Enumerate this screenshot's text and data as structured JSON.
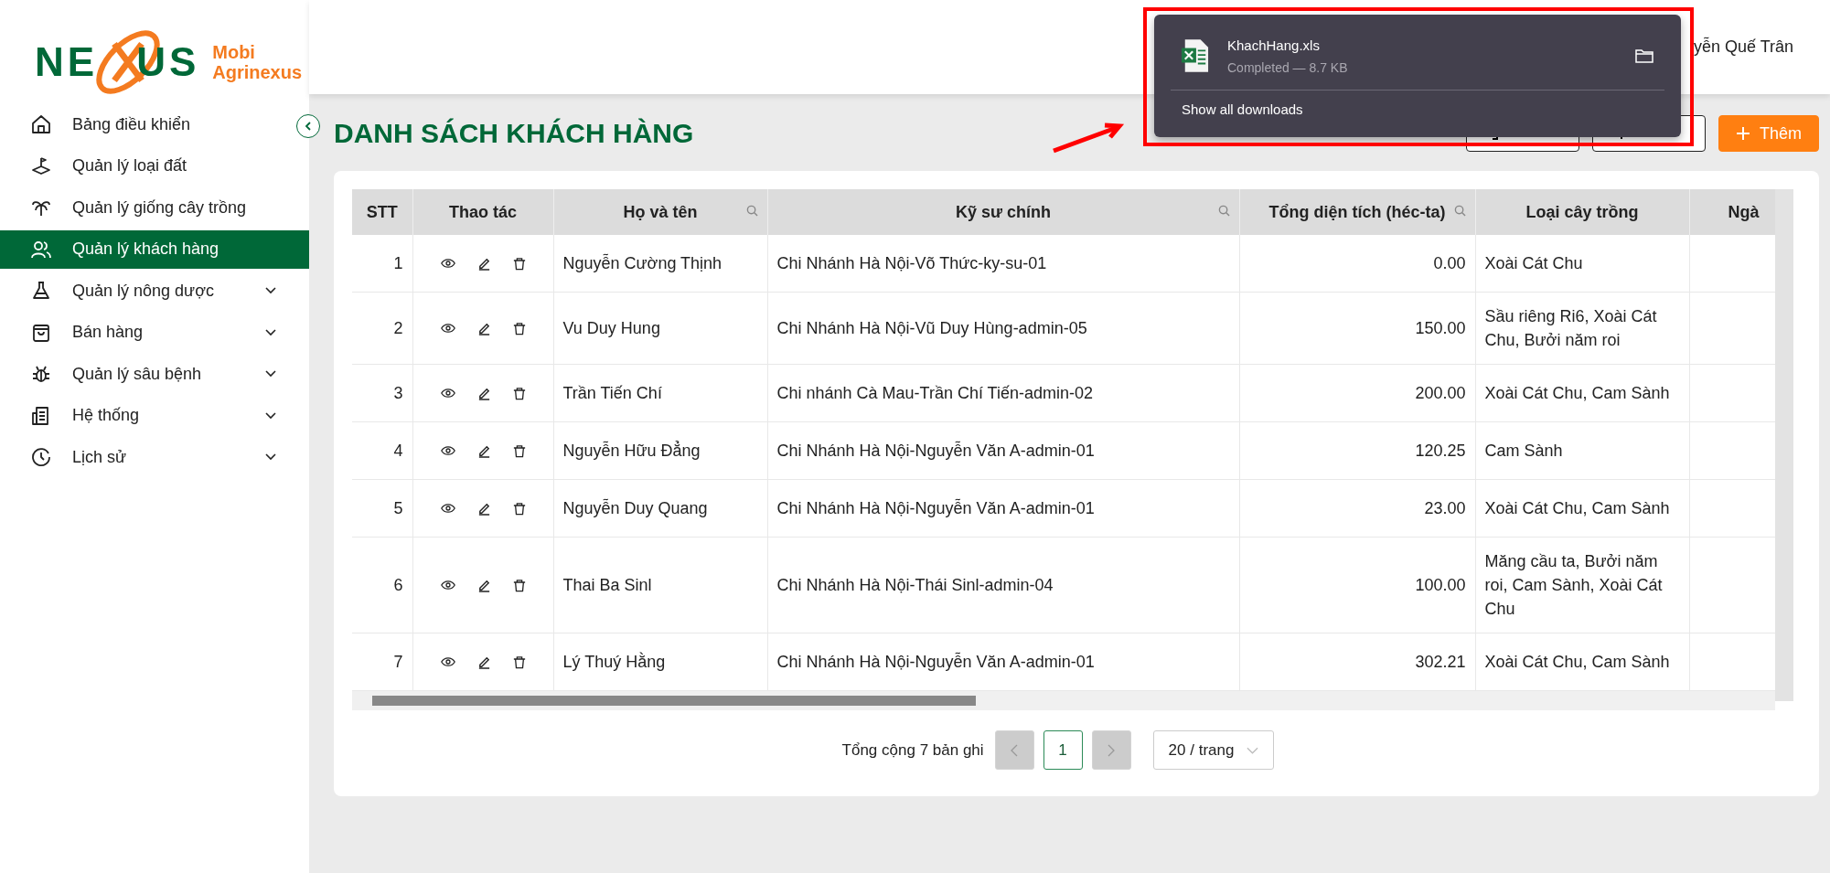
{
  "logo": {
    "wordmark_left": "NE",
    "wordmark_right": "US",
    "line1": "Mobi",
    "line2": "Agrinexus"
  },
  "sidebar": {
    "items": [
      {
        "label": "Bảng điều khiển",
        "kind": "home",
        "expandable": false,
        "selected": false
      },
      {
        "label": "Quản lý loại đất",
        "kind": "soil",
        "expandable": false,
        "selected": false
      },
      {
        "label": "Quản lý giống cây trồng",
        "kind": "palm",
        "expandable": false,
        "selected": false
      },
      {
        "label": "Quản lý khách hàng",
        "kind": "users",
        "expandable": false,
        "selected": true
      },
      {
        "label": "Quản lý nông dược",
        "kind": "flask",
        "expandable": true,
        "selected": false
      },
      {
        "label": "Bán hàng",
        "kind": "bag",
        "expandable": true,
        "selected": false
      },
      {
        "label": "Quản lý sâu bệnh",
        "kind": "bug",
        "expandable": true,
        "selected": false
      },
      {
        "label": "Hệ thống",
        "kind": "building",
        "expandable": true,
        "selected": false
      },
      {
        "label": "Lịch sử",
        "kind": "clock",
        "expandable": true,
        "selected": false
      }
    ]
  },
  "header": {
    "user_name": "yễn Quế Trân"
  },
  "page": {
    "title": "DANH SÁCH KHÁCH HÀNG",
    "buttons": [
      {
        "kind": "export"
      },
      {
        "kind": "import"
      },
      {
        "label": "Thêm",
        "kind": "add"
      }
    ]
  },
  "table": {
    "columns": [
      {
        "label": "STT",
        "kind": "index",
        "searchable": false
      },
      {
        "label": "Thao tác",
        "kind": "actions",
        "searchable": false
      },
      {
        "label": "Họ và tên",
        "kind": "text",
        "searchable": true
      },
      {
        "label": "Kỹ sư chính",
        "kind": "text",
        "searchable": true
      },
      {
        "label": "Tổng diện tích (héc-ta)",
        "kind": "number",
        "searchable": true
      },
      {
        "label": "Loại cây trồng",
        "kind": "text",
        "searchable": false
      },
      {
        "label": "Ngà",
        "kind": "text",
        "searchable": false
      }
    ],
    "rows": [
      {
        "stt": "1",
        "name": "Nguyễn Cường Thịnh",
        "engineer": "Chi Nhánh Hà Nội-Võ Thức-ky-su-01",
        "area": "0.00",
        "crops": "Xoài Cát Chu"
      },
      {
        "stt": "2",
        "name": "Vu Duy Hung",
        "engineer": "Chi Nhánh Hà Nội-Vũ Duy Hùng-admin-05",
        "area": "150.00",
        "crops": "Sầu riêng Ri6, Xoài Cát Chu, Bưởi năm roi"
      },
      {
        "stt": "3",
        "name": "Trần Tiến Chí",
        "engineer": "Chi nhánh Cà Mau-Trần Chí Tiến-admin-02",
        "area": "200.00",
        "crops": "Xoài Cát Chu, Cam Sành"
      },
      {
        "stt": "4",
        "name": "Nguyễn Hữu Đẳng",
        "engineer": "Chi Nhánh Hà Nội-Nguyễn Văn A-admin-01",
        "area": "120.25",
        "crops": "Cam Sành"
      },
      {
        "stt": "5",
        "name": "Nguyễn Duy Quang",
        "engineer": "Chi Nhánh Hà Nội-Nguyễn Văn A-admin-01",
        "area": "23.00",
        "crops": "Xoài Cát Chu, Cam Sành"
      },
      {
        "stt": "6",
        "name": "Thai Ba Sinl",
        "engineer": "Chi Nhánh Hà Nội-Thái Sinl-admin-04",
        "area": "100.00",
        "crops": "Măng cầu ta, Bưởi năm roi, Cam Sành, Xoài Cát Chu"
      },
      {
        "stt": "7",
        "name": "Lý Thuý Hằng",
        "engineer": "Chi Nhánh Hà Nội-Nguyễn Văn A-admin-01",
        "area": "302.21",
        "crops": "Xoài Cát Chu, Cam Sành"
      }
    ]
  },
  "pagination": {
    "total": "Tổng cộng 7 bản ghi",
    "prev_disabled": true,
    "next_disabled": true,
    "pages": [
      {
        "label": "1",
        "selected": true
      }
    ],
    "page_size": "20 / trang"
  },
  "download_popup": {
    "file_name": "KhachHang.xls",
    "status": "Completed — 8.7 KB",
    "show_all": "Show all downloads"
  }
}
